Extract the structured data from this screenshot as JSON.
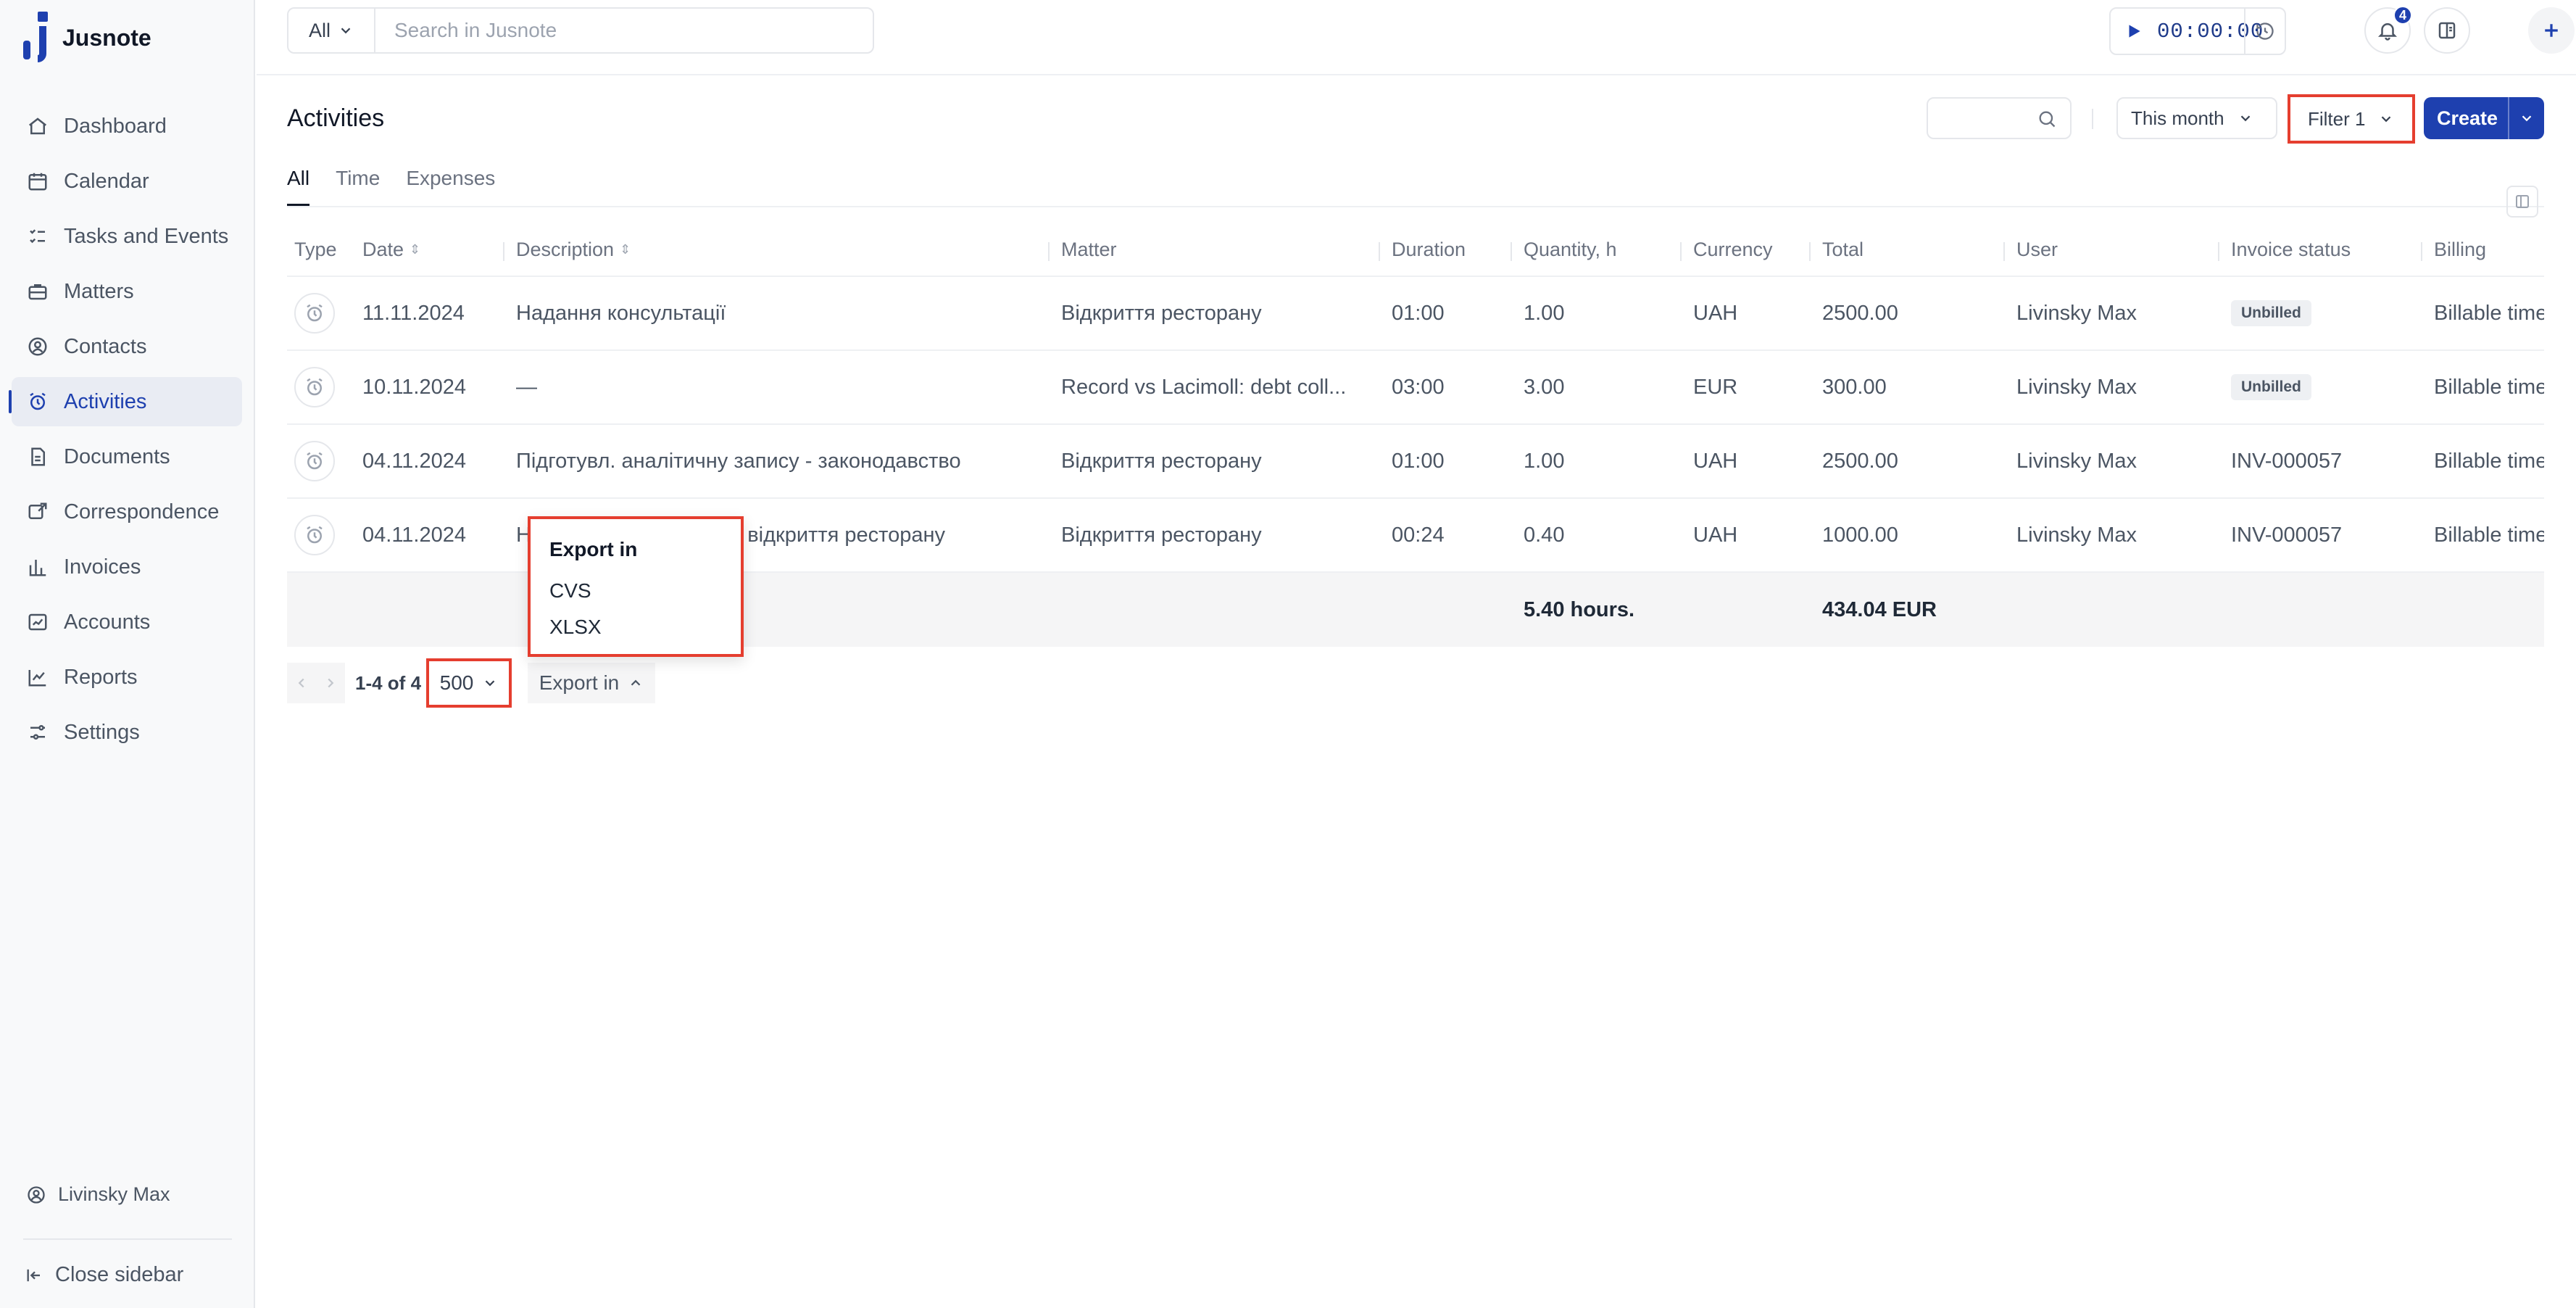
{
  "brand": {
    "name": "Jusnote"
  },
  "nav": [
    {
      "label": "Dashboard",
      "icon": "home-icon"
    },
    {
      "label": "Calendar",
      "icon": "calendar-icon"
    },
    {
      "label": "Tasks and Events",
      "icon": "tasks-icon"
    },
    {
      "label": "Matters",
      "icon": "briefcase-icon"
    },
    {
      "label": "Contacts",
      "icon": "contacts-icon"
    },
    {
      "label": "Activities",
      "icon": "alarm-icon",
      "active": true
    },
    {
      "label": "Documents",
      "icon": "document-icon"
    },
    {
      "label": "Correspondence",
      "icon": "correspondence-icon"
    },
    {
      "label": "Invoices",
      "icon": "invoice-icon"
    },
    {
      "label": "Accounts",
      "icon": "accounts-icon"
    },
    {
      "label": "Reports",
      "icon": "reports-icon"
    },
    {
      "label": "Settings",
      "icon": "settings-icon"
    }
  ],
  "sidebar_footer": {
    "user": "Livinsky Max",
    "close": "Close sidebar"
  },
  "topbar": {
    "scope": "All",
    "search_placeholder": "Search in Jusnote",
    "timer": "00:00:00",
    "notifications_count": "4"
  },
  "page": {
    "title": "Activities",
    "tabs": [
      "All",
      "Time",
      "Expenses"
    ],
    "period": "This month",
    "filter": "Filter 1",
    "create": "Create"
  },
  "table": {
    "headers": [
      "Type",
      "Date",
      "Description",
      "Matter",
      "Duration",
      "Quantity, h",
      "Currency",
      "Total",
      "User",
      "Invoice status",
      "Billing"
    ],
    "rows": [
      {
        "date": "11.11.2024",
        "description": "Надання консультації",
        "matter": "Відкриття ресторану",
        "duration": "01:00",
        "quantity": "1.00",
        "currency": "UAH",
        "total": "2500.00",
        "user": "Livinsky Max",
        "invoice": "Unbilled",
        "invoice_pill": true,
        "billing": "Billable time"
      },
      {
        "date": "10.11.2024",
        "description": "—",
        "matter": "Record vs Lacimoll: debt coll...",
        "duration": "03:00",
        "quantity": "3.00",
        "currency": "EUR",
        "total": "300.00",
        "user": "Livinsky Max",
        "invoice": "Unbilled",
        "invoice_pill": true,
        "billing": "Billable time"
      },
      {
        "date": "04.11.2024",
        "description": "Підготувл. аналітичну запису - законодавство",
        "matter": "Відкриття ресторану",
        "duration": "01:00",
        "quantity": "1.00",
        "currency": "UAH",
        "total": "2500.00",
        "user": "Livinsky Max",
        "invoice": "INV-000057",
        "invoice_pill": false,
        "billing": "Billable time"
      },
      {
        "date": "04.11.2024",
        "description": "Н                              одо відкриття ресторану",
        "matter": "Відкриття ресторану",
        "duration": "00:24",
        "quantity": "0.40",
        "currency": "UAH",
        "total": "1000.00",
        "user": "Livinsky Max",
        "invoice": "INV-000057",
        "invoice_pill": false,
        "billing": "Billable time"
      }
    ],
    "totals": {
      "quantity": "5.40 hours.",
      "total": "434.04 EUR"
    }
  },
  "pager": {
    "range": "1-4 of 4",
    "page_size": "500",
    "export": "Export in"
  },
  "export_menu": {
    "title": "Export in",
    "options": [
      "CVS",
      "XLSX"
    ]
  },
  "colors": {
    "accent": "#1e40af",
    "highlight": "#e53e2f"
  }
}
